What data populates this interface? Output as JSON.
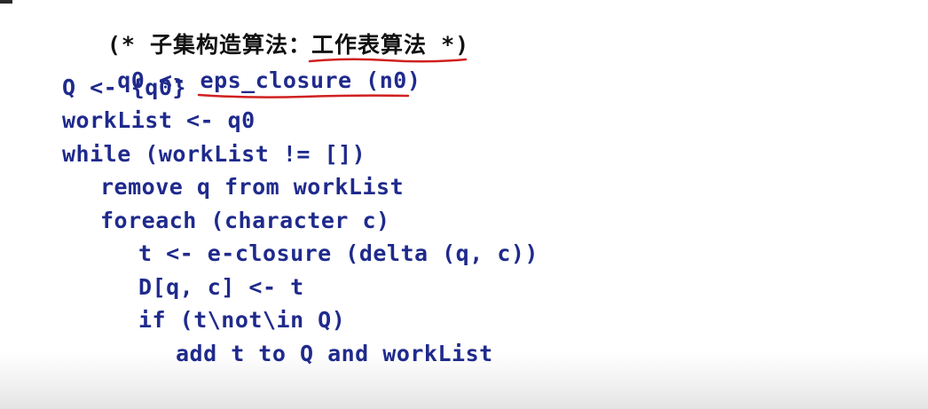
{
  "title_line": {
    "open": "(* ",
    "label": "子集构造算法：",
    "highlight": "工作表算法",
    "close": " *)"
  },
  "lines": [
    {
      "pre": "q0 <- ",
      "highlight": "eps_closure",
      "post": " (n0)"
    },
    {
      "text": "Q <- {q0}"
    },
    {
      "text": "workList <- q0"
    },
    {
      "text": "while (workList != [])"
    },
    {
      "text": "remove q from workList"
    },
    {
      "text": "foreach (character c)"
    },
    {
      "text": "t <- e-closure (delta (q, c))"
    },
    {
      "text": "D[q, c] <- t"
    },
    {
      "text": "if (t\\not\\in Q)"
    },
    {
      "text": "add t to Q and workList"
    }
  ],
  "colors": {
    "code": "#1f2a8c",
    "comment": "#111111",
    "underline": "#d02020"
  }
}
